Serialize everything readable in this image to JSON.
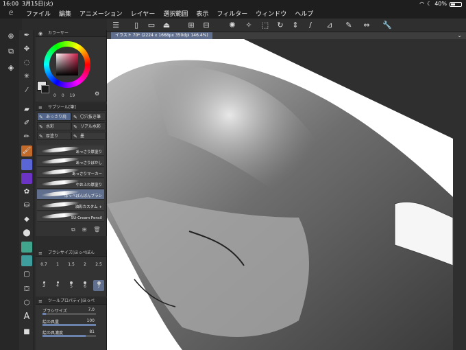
{
  "status": {
    "time": "16:00",
    "date": "3月15日(火)",
    "battery": "40%",
    "battery_fraction": 0.4
  },
  "menu": [
    "ファイル",
    "編集",
    "アニメーション",
    "レイヤー",
    "選択範囲",
    "表示",
    "フィルター",
    "ウィンドウ",
    "ヘルプ"
  ],
  "color_panel": {
    "title": "カラーサー",
    "main_color": "#d11d4a",
    "readout": [
      "0",
      "0",
      "19"
    ]
  },
  "subtool_panel": {
    "title": "サブツール[筆]",
    "tabs": [
      "あっさり肩",
      "〇穴抜き筆",
      "水彩",
      "リアル水彩",
      "厚塗り",
      "墨"
    ],
    "brushes": [
      "あっさり厚塗り",
      "あっさりぼかし",
      "あっさりマーカー",
      "やおふわ厚塗り",
      "ぽっぺぽんぽんブラシ",
      "油彩カスタム +",
      "SU-Cream Pencil"
    ]
  },
  "brush_size_panel": {
    "title": "ブラシサイズ(ほっぺぽん",
    "sizes": [
      "0.7",
      "1",
      "1.5",
      "2",
      "2.5",
      "3",
      "4",
      "5",
      "6",
      "7"
    ],
    "selected": "7"
  },
  "tool_property_panel": {
    "title": "ツールプロパティ[ほっぺ",
    "rows": [
      {
        "label": "ブラシサイズ",
        "value": "7.0",
        "fraction": 0.07
      },
      {
        "label": "絵の具量",
        "value": "100",
        "fraction": 1.0
      },
      {
        "label": "絵の具濃度",
        "value": "81",
        "fraction": 0.81
      }
    ]
  },
  "canvas": {
    "tab_title": "イラスト 70* (2224 x 1668px 350dpi 146.4%)"
  },
  "colors": {
    "menu_bg": "#1e1e1e",
    "panel_bg": "#333333",
    "accent": "#5f6f8d"
  }
}
